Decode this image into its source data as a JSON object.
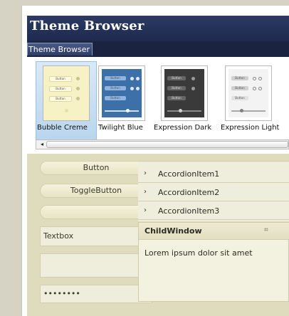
{
  "window": {
    "title": "Theme Browser",
    "tab_label": "Theme Browser"
  },
  "themes": [
    {
      "name": "Bubble Creme",
      "selected": true,
      "color": "#f3eebb"
    },
    {
      "name": "Twilight Blue",
      "selected": false,
      "color": "#3d6fa8"
    },
    {
      "name": "Expression Dark",
      "selected": false,
      "color": "#3a3a3a"
    },
    {
      "name": "Expression Light",
      "selected": false,
      "color": "#d9d9d9"
    }
  ],
  "thumb_button_label": "Button",
  "scroll_arrow": "◂",
  "controls": {
    "button_label": "Button",
    "toggle_label": "ToggleButton",
    "combo_arrow": "▾",
    "textbox_value": "Textbox",
    "password_value": "••••••••"
  },
  "accordion": {
    "chevron": "›",
    "items": [
      "AccordionItem1",
      "AccordionItem2",
      "AccordionItem3"
    ]
  },
  "child_window": {
    "title": "ChildWindow",
    "close_glyph": "⌗",
    "body": "Lorem ipsum dolor sit amet"
  },
  "colors": {
    "title_bar": "#1e2a4e",
    "control_bg": "#dfdcbd",
    "selection": "#b9d5ee"
  }
}
